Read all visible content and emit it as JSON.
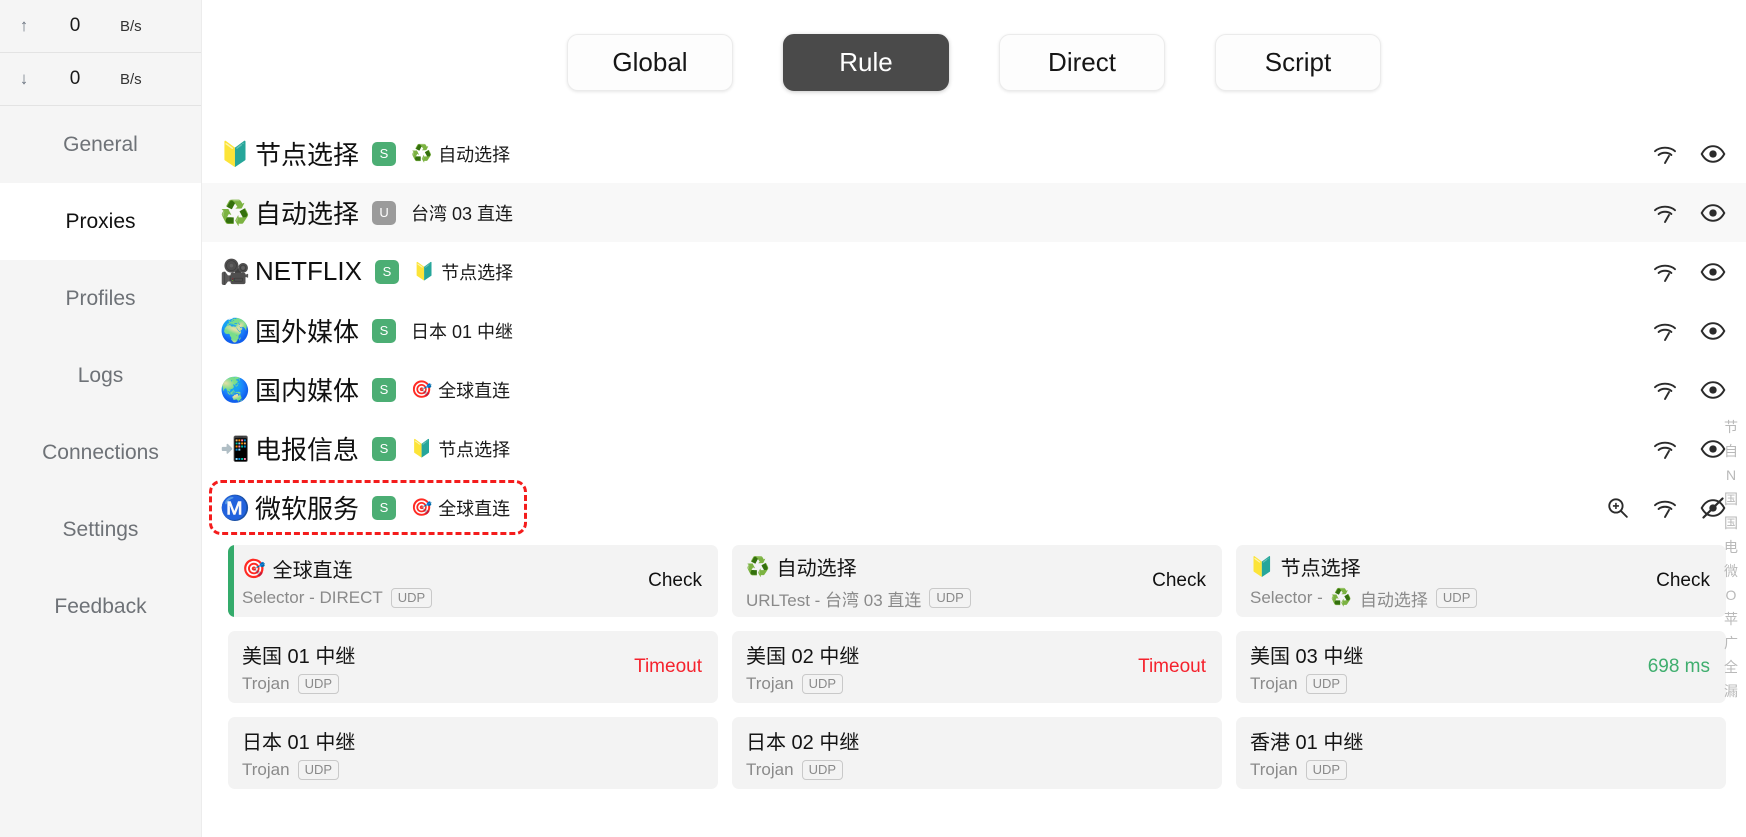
{
  "sidebar": {
    "traffic": [
      {
        "icon": "upload-arrow-icon",
        "arrow": "↑",
        "value": "0",
        "unit": "B/s"
      },
      {
        "icon": "download-arrow-icon",
        "arrow": "↓",
        "value": "0",
        "unit": "B/s"
      }
    ],
    "items": [
      {
        "label": "General",
        "active": false
      },
      {
        "label": "Proxies",
        "active": true
      },
      {
        "label": "Profiles",
        "active": false
      },
      {
        "label": "Logs",
        "active": false
      },
      {
        "label": "Connections",
        "active": false
      },
      {
        "label": "Settings",
        "active": false
      },
      {
        "label": "Feedback",
        "active": false
      }
    ]
  },
  "modes": {
    "items": [
      {
        "label": "Global",
        "active": false
      },
      {
        "label": "Rule",
        "active": true
      },
      {
        "label": "Direct",
        "active": false
      },
      {
        "label": "Script",
        "active": false
      }
    ],
    "active_color": "#4a4a4a"
  },
  "groups": [
    {
      "emoji": "🔰",
      "emoji_name": "beginner-badge-icon",
      "name": "节点选择",
      "type_badge": "S",
      "selected_emoji": "♻️",
      "selected_emoji_name": "recycle-icon",
      "selected": "自动选择",
      "alt": false,
      "highlight": false,
      "expanded": false,
      "eye_state": "visible"
    },
    {
      "emoji": "♻️",
      "emoji_name": "recycle-icon",
      "name": "自动选择",
      "type_badge": "U",
      "selected_emoji": "",
      "selected_emoji_name": "none",
      "selected": "台湾 03 直连",
      "alt": true,
      "highlight": false,
      "expanded": false,
      "eye_state": "visible"
    },
    {
      "emoji": "🎥",
      "emoji_name": "movie-camera-icon",
      "name": "NETFLIX",
      "type_badge": "S",
      "selected_emoji": "🔰",
      "selected_emoji_name": "beginner-badge-icon",
      "selected": "节点选择",
      "alt": false,
      "highlight": false,
      "expanded": false,
      "eye_state": "visible"
    },
    {
      "emoji": "🌍",
      "emoji_name": "globe-africa-icon",
      "name": "国外媒体",
      "type_badge": "S",
      "selected_emoji": "",
      "selected_emoji_name": "none",
      "selected": "日本 01 中继",
      "alt": false,
      "highlight": false,
      "expanded": false,
      "eye_state": "visible"
    },
    {
      "emoji": "🌏",
      "emoji_name": "globe-asia-icon",
      "name": "国内媒体",
      "type_badge": "S",
      "selected_emoji": "🎯",
      "selected_emoji_name": "target-icon",
      "selected": "全球直连",
      "alt": false,
      "highlight": false,
      "expanded": false,
      "eye_state": "visible"
    },
    {
      "emoji": "📲",
      "emoji_name": "mobile-phone-arrow-icon",
      "name": "电报信息",
      "type_badge": "S",
      "selected_emoji": "🔰",
      "selected_emoji_name": "beginner-badge-icon",
      "selected": "节点选择",
      "alt": false,
      "highlight": false,
      "expanded": false,
      "eye_state": "visible"
    },
    {
      "emoji": "Ⓜ️",
      "emoji_name": "circled-m-icon",
      "name": "微软服务",
      "type_badge": "S",
      "selected_emoji": "🎯",
      "selected_emoji_name": "target-icon",
      "selected": "全球直连",
      "alt": false,
      "highlight": true,
      "expanded": true,
      "eye_state": "hidden"
    }
  ],
  "nodes": [
    {
      "emoji": "🎯",
      "emoji_name": "target-icon",
      "name": "全球直连",
      "sub_prefix": "Selector - ",
      "sub_emoji": "",
      "sub_emoji_name": "none",
      "sub_value": "DIRECT",
      "udp": "UDP",
      "status": "Check",
      "status_kind": "check",
      "selected": true
    },
    {
      "emoji": "♻️",
      "emoji_name": "recycle-icon",
      "name": "自动选择",
      "sub_prefix": "URLTest - ",
      "sub_emoji": "",
      "sub_emoji_name": "none",
      "sub_value": "台湾 03 直连",
      "udp": "UDP",
      "status": "Check",
      "status_kind": "check",
      "selected": false
    },
    {
      "emoji": "🔰",
      "emoji_name": "beginner-badge-icon",
      "name": "节点选择",
      "sub_prefix": "Selector - ",
      "sub_emoji": "♻️",
      "sub_emoji_name": "recycle-icon",
      "sub_value": "自动选择",
      "udp": "UDP",
      "status": "Check",
      "status_kind": "check",
      "selected": false
    },
    {
      "emoji": "",
      "emoji_name": "none",
      "name": "美国 01 中继",
      "sub_prefix": "Trojan",
      "sub_emoji": "",
      "sub_emoji_name": "none",
      "sub_value": "",
      "udp": "UDP",
      "status": "Timeout",
      "status_kind": "timeout",
      "selected": false
    },
    {
      "emoji": "",
      "emoji_name": "none",
      "name": "美国 02 中继",
      "sub_prefix": "Trojan",
      "sub_emoji": "",
      "sub_emoji_name": "none",
      "sub_value": "",
      "udp": "UDP",
      "status": "Timeout",
      "status_kind": "timeout",
      "selected": false
    },
    {
      "emoji": "",
      "emoji_name": "none",
      "name": "美国 03 中继",
      "sub_prefix": "Trojan",
      "sub_emoji": "",
      "sub_emoji_name": "none",
      "sub_value": "",
      "udp": "UDP",
      "status": "698 ms",
      "status_kind": "ms",
      "selected": false
    },
    {
      "emoji": "",
      "emoji_name": "none",
      "name": "日本 01 中继",
      "sub_prefix": "Trojan",
      "sub_emoji": "",
      "sub_emoji_name": "none",
      "sub_value": "",
      "udp": "UDP",
      "status": "",
      "status_kind": "timeout",
      "selected": false
    },
    {
      "emoji": "",
      "emoji_name": "none",
      "name": "日本 02 中继",
      "sub_prefix": "Trojan",
      "sub_emoji": "",
      "sub_emoji_name": "none",
      "sub_value": "",
      "udp": "UDP",
      "status": "",
      "status_kind": "timeout",
      "selected": false
    },
    {
      "emoji": "",
      "emoji_name": "none",
      "name": "香港 01 中继",
      "sub_prefix": "Trojan",
      "sub_emoji": "",
      "sub_emoji_name": "none",
      "sub_value": "",
      "udp": "UDP",
      "status": "",
      "status_kind": "ms",
      "selected": false
    }
  ],
  "rail": [
    "节",
    "自",
    "N",
    "国",
    "国",
    "电",
    "微",
    "O",
    "苹",
    "广",
    "全",
    "漏"
  ],
  "colors": {
    "accent_green": "#34ab6b",
    "badge_green": "#4cae74",
    "badge_gray": "#9b9b9b",
    "timeout_red": "#f5222d",
    "highlight_red": "#f41c1c",
    "active_mode_bg": "#4a4a4a"
  }
}
